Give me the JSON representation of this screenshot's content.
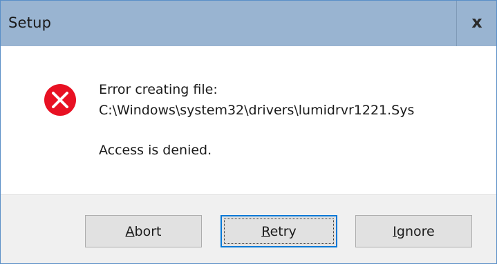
{
  "window": {
    "title": "Setup",
    "close_glyph": "x"
  },
  "message": {
    "icon": "error-icon",
    "line1": "Error creating file:",
    "line2": "C:\\Windows\\system32\\drivers\\lumidrvr1221.Sys",
    "line3": "Access is denied."
  },
  "buttons": {
    "abort": {
      "first": "A",
      "rest": "bort"
    },
    "retry": {
      "first": "R",
      "rest": "etry"
    },
    "ignore": {
      "first": "I",
      "rest": "gnore"
    }
  },
  "colors": {
    "titlebar": "#99b4d1",
    "error_red": "#e81123",
    "focus_blue": "#0078d7",
    "footer": "#f0f0f0"
  }
}
